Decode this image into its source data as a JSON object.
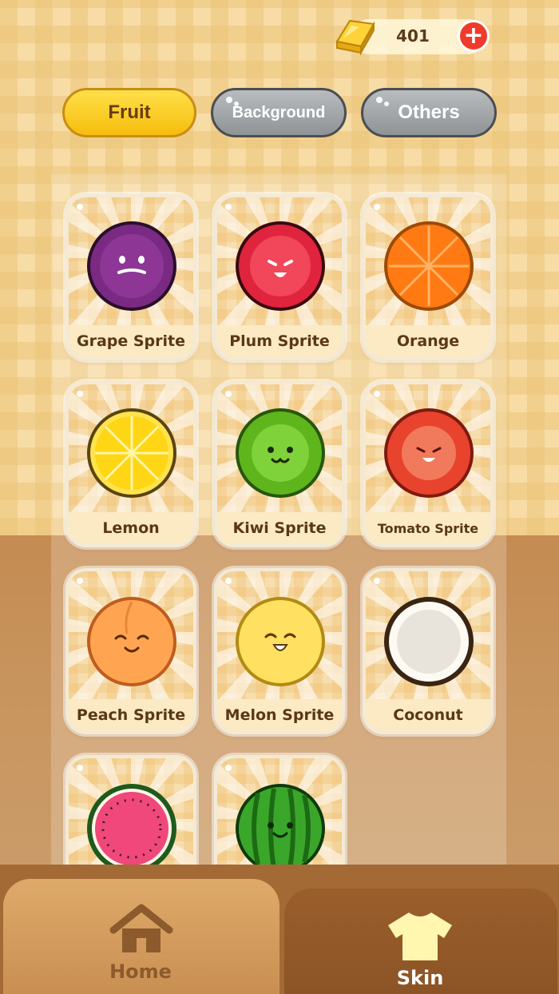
{
  "currency": {
    "amount": "401",
    "add_label": "+"
  },
  "tabs": {
    "fruit": "Fruit",
    "background": "Background",
    "others": "Others"
  },
  "cards": [
    {
      "label": "Grape Sprite",
      "icon": "grape-sprite-icon"
    },
    {
      "label": "Plum Sprite",
      "icon": "plum-sprite-icon"
    },
    {
      "label": "Orange",
      "icon": "orange-icon"
    },
    {
      "label": "Lemon",
      "icon": "lemon-icon"
    },
    {
      "label": "Kiwi Sprite",
      "icon": "kiwi-sprite-icon"
    },
    {
      "label": "Tomato Sprite",
      "icon": "tomato-sprite-icon"
    },
    {
      "label": "Peach Sprite",
      "icon": "peach-sprite-icon"
    },
    {
      "label": "Melon Sprite",
      "icon": "melon-sprite-icon"
    },
    {
      "label": "Coconut",
      "icon": "coconut-icon"
    },
    {
      "label": "",
      "icon": "watermelon-slice-icon"
    },
    {
      "label": "",
      "icon": "watermelon-sprite-icon"
    }
  ],
  "nav": {
    "home": "Home",
    "skin": "Skin"
  },
  "colors": {
    "active_tab": "#f6bd0c",
    "inactive_tab": "#8f9396",
    "active_nav_label": "#ffffff",
    "inactive_nav_label": "#8c5a2c"
  }
}
